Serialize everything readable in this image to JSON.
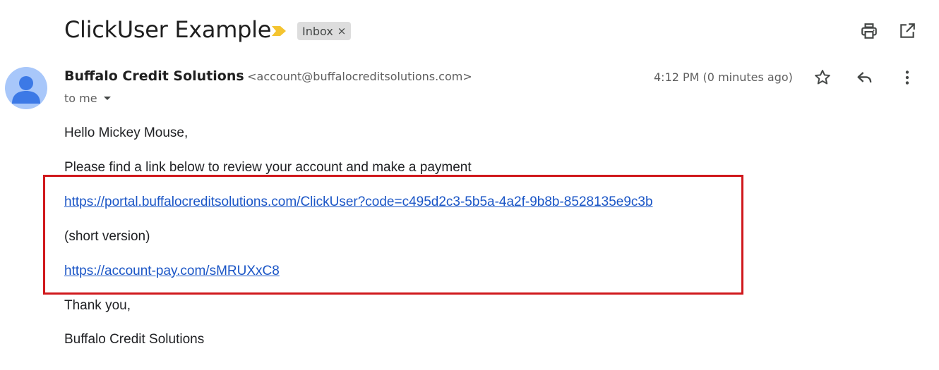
{
  "header": {
    "subject": "ClickUser Example",
    "label_chip": "Inbox",
    "label_chip_close": "×",
    "icons": [
      "important-marker-icon",
      "print-icon",
      "open-in-new-window-icon"
    ]
  },
  "sender": {
    "name": "Buffalo Credit Solutions",
    "email": "<account@buffalocreditsolutions.com>",
    "recipient": "to me",
    "timestamp": "4:12 PM (0 minutes ago)",
    "icons": [
      "avatar-person-icon",
      "caret-down-icon",
      "star-icon",
      "reply-icon",
      "more-vert-icon"
    ]
  },
  "body": {
    "greeting": "Hello Mickey Mouse,",
    "intro": "Please find a link below to review your account and make a payment",
    "link_long": "https://portal.buffalocreditsolutions.com/ClickUser?code=c495d2c3-5b5a-4a2f-9b8b-8528135e9c3b",
    "short_label": "(short version)",
    "link_short": "https://account-pay.com/sMRUXxC8",
    "thanks": "Thank you,",
    "signature": "Buffalo Credit Solutions"
  },
  "colors": {
    "link": "#1a55c6",
    "highlight_border": "#d0181c",
    "important_marker": "#f4c430",
    "avatar_bg": "#a8c7fa",
    "avatar_fg": "#3c79e6"
  }
}
